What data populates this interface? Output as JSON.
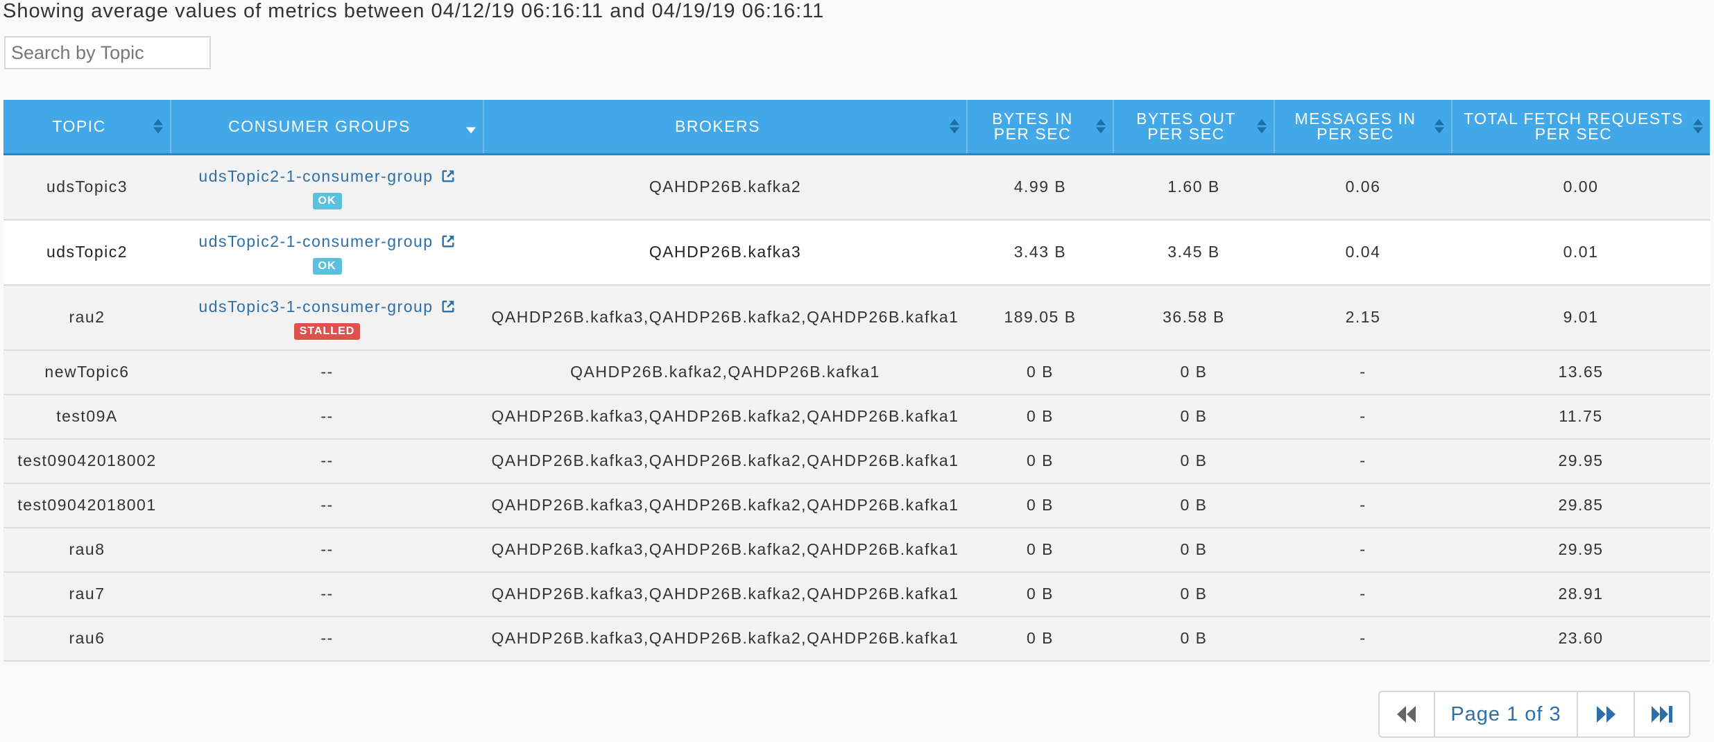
{
  "summary_text": "Showing average values of metrics between 04/12/19 06:16:11 and 04/19/19 06:16:11",
  "search": {
    "placeholder": "Search by Topic",
    "value": ""
  },
  "table": {
    "headers": [
      "TOPIC",
      "CONSUMER GROUPS",
      "BROKERS",
      "BYTES IN PER SEC",
      "BYTES OUT PER SEC",
      "MESSAGES IN PER SEC",
      "TOTAL FETCH REQUESTS PER SEC"
    ],
    "rows": [
      {
        "topic": "udsTopic3",
        "consumer_group": "udsTopic2-1-consumer-group",
        "status": "OK",
        "brokers": "QAHDP26B.kafka2",
        "bytes_in": "4.99 B",
        "bytes_out": "1.60 B",
        "messages_in": "0.06",
        "fetch_requests": "0.00"
      },
      {
        "topic": "udsTopic2",
        "consumer_group": "udsTopic2-1-consumer-group",
        "status": "OK",
        "brokers": "QAHDP26B.kafka3",
        "bytes_in": "3.43 B",
        "bytes_out": "3.45 B",
        "messages_in": "0.04",
        "fetch_requests": "0.01"
      },
      {
        "topic": "rau2",
        "consumer_group": "udsTopic3-1-consumer-group",
        "status": "STALLED",
        "brokers": "QAHDP26B.kafka3,QAHDP26B.kafka2,QAHDP26B.kafka1",
        "bytes_in": "189.05 B",
        "bytes_out": "36.58 B",
        "messages_in": "2.15",
        "fetch_requests": "9.01"
      },
      {
        "topic": "newTopic6",
        "consumer_group": "--",
        "brokers": "QAHDP26B.kafka2,QAHDP26B.kafka1",
        "bytes_in": "0 B",
        "bytes_out": "0 B",
        "messages_in": "-",
        "fetch_requests": "13.65"
      },
      {
        "topic": "test09A",
        "consumer_group": "--",
        "brokers": "QAHDP26B.kafka3,QAHDP26B.kafka2,QAHDP26B.kafka1",
        "bytes_in": "0 B",
        "bytes_out": "0 B",
        "messages_in": "-",
        "fetch_requests": "11.75"
      },
      {
        "topic": "test09042018002",
        "consumer_group": "--",
        "brokers": "QAHDP26B.kafka3,QAHDP26B.kafka2,QAHDP26B.kafka1",
        "bytes_in": "0 B",
        "bytes_out": "0 B",
        "messages_in": "-",
        "fetch_requests": "29.95"
      },
      {
        "topic": "test09042018001",
        "consumer_group": "--",
        "brokers": "QAHDP26B.kafka3,QAHDP26B.kafka2,QAHDP26B.kafka1",
        "bytes_in": "0 B",
        "bytes_out": "0 B",
        "messages_in": "-",
        "fetch_requests": "29.85"
      },
      {
        "topic": "rau8",
        "consumer_group": "--",
        "brokers": "QAHDP26B.kafka3,QAHDP26B.kafka2,QAHDP26B.kafka1",
        "bytes_in": "0 B",
        "bytes_out": "0 B",
        "messages_in": "-",
        "fetch_requests": "29.95"
      },
      {
        "topic": "rau7",
        "consumer_group": "--",
        "brokers": "QAHDP26B.kafka3,QAHDP26B.kafka2,QAHDP26B.kafka1",
        "bytes_in": "0 B",
        "bytes_out": "0 B",
        "messages_in": "-",
        "fetch_requests": "28.91"
      },
      {
        "topic": "rau6",
        "consumer_group": "--",
        "brokers": "QAHDP26B.kafka3,QAHDP26B.kafka2,QAHDP26B.kafka1",
        "bytes_in": "0 B",
        "bytes_out": "0 B",
        "messages_in": "-",
        "fetch_requests": "23.60"
      }
    ]
  },
  "pagination": {
    "label": "Page 1 of 3",
    "first_icon": "double-chevron-left-icon",
    "next_icon": "double-chevron-right-icon",
    "last_icon": "chevron-right-bar-icon"
  },
  "colors": {
    "header_bg": "#42a8e7",
    "link": "#2f6fa7",
    "badge_ok": "#5bc0de",
    "badge_stalled": "#d9534f"
  }
}
